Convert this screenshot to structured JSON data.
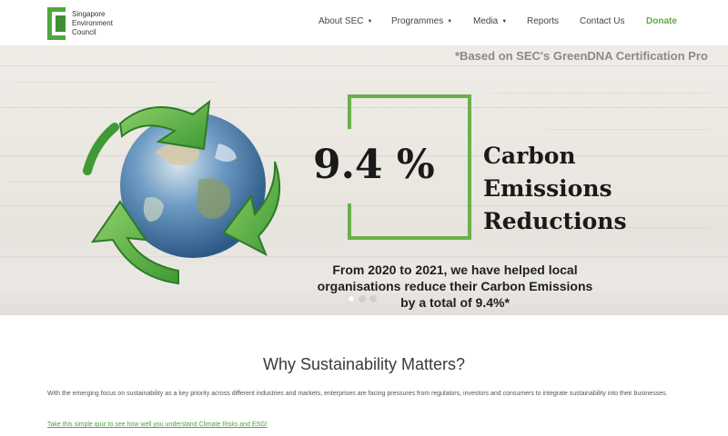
{
  "header": {
    "logo_lines": [
      "Singapore",
      "Environment",
      "Council"
    ],
    "nav": {
      "about": "About SEC",
      "programmes": "Programmes",
      "media": "Media",
      "reports": "Reports",
      "contact": "Contact Us",
      "donate": "Donate"
    }
  },
  "hero": {
    "cert_note": "*Based on SEC's GreenDNA Certification Pro",
    "stat_value": "9.4 %",
    "stat_label_lines": [
      "Carbon",
      "Emissions",
      "Reductions"
    ],
    "caption_lines": [
      "From 2020 to 2021, we have helped local",
      "organisations reduce their Carbon Emissions",
      "by a total of 9.4%*"
    ],
    "slides_total": 3,
    "active_slide": 1
  },
  "content": {
    "title": "Why Sustainability Matters?",
    "body": "With the emerging focus on sustainability as a key priority across different industries and markets, enterprises are facing pressures from regulators, investors and consumers to integrate sustainability into their businesses.",
    "quiz_link": "Take this simple quiz to see how well you understand Climate Risks and ESG!"
  },
  "colors": {
    "brand_green": "#6ab04c",
    "donate_green": "#5aad45",
    "link_green": "#4aa43a"
  },
  "icons": [
    "logo-mark-icon",
    "chevron-down-icon",
    "recycle-globe-image"
  ]
}
